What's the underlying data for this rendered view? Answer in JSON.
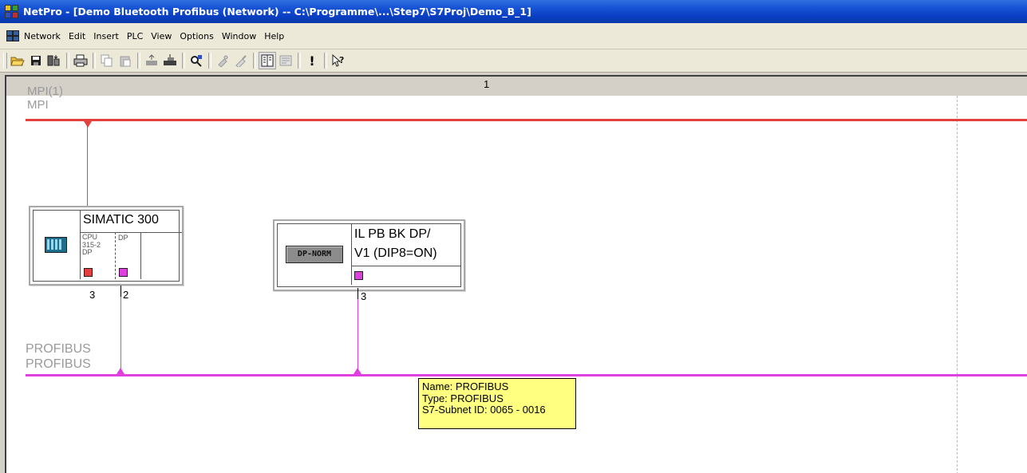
{
  "window": {
    "title": "NetPro - [Demo Bluetooth Profibus (Network) -- C:\\Programme\\...\\Step7\\S7Proj\\Demo_B_1]"
  },
  "menu": {
    "items": [
      "Network",
      "Edit",
      "Insert",
      "PLC",
      "View",
      "Options",
      "Window",
      "Help"
    ]
  },
  "toolbar": {
    "buttons": [
      "open-icon",
      "save-icon",
      "download-icon",
      "print-icon",
      "copy-icon",
      "paste-icon",
      "upload-icon",
      "download-to-plc-icon",
      "find-icon",
      "stamp-icon",
      "brush-icon",
      "catalog-icon",
      "properties-icon",
      "error-icon",
      "help-pointer-icon"
    ],
    "colors": {
      "enabled": "#000000",
      "disabled": "#9c9c9c"
    }
  },
  "canvas": {
    "column_number": "1",
    "mpi_label_line1": "MPI(1)",
    "mpi_label_line2": "MPI",
    "profibus_label_line1": "PROFIBUS",
    "profibus_label_line2": "PROFIBUS",
    "mpi_color": "#e34040",
    "profibus_color": "#e040e0"
  },
  "stations": {
    "simatic": {
      "name": "SIMATIC 300",
      "cpu_label_1": "CPU",
      "cpu_label_2": "315-2",
      "cpu_label_3": "DP",
      "dp_label": "DP",
      "port_left": "3",
      "port_right": "2"
    },
    "il_pb": {
      "name_line1": "IL PB BK DP/",
      "name_line2": "V1 (DIP8=ON)",
      "icon_text": "DP-NORM",
      "port": "3"
    }
  },
  "tooltip": {
    "line1": "Name: PROFIBUS",
    "line2": "Type: PROFIBUS",
    "line3": "S7-Subnet ID: 0065 - 0016"
  }
}
